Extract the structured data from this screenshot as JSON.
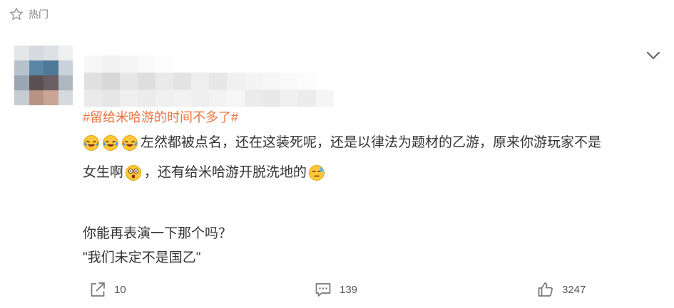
{
  "header": {
    "hot_label": "热门"
  },
  "comment": {
    "topic": "#留给米哈游的时间不多了#",
    "line1": "左然都被点名，还在这装死呢，还是以律法为题材的乙游，原来你游玩家不是",
    "line2_a": "女生啊",
    "line2_b": "，还有给米哈游开脱洗地的",
    "line5": "你能再表演一下那个吗？",
    "line6": "\"我们未定不是国乙\""
  },
  "actions": {
    "repost_count": "10",
    "comment_count": "139",
    "like_count": "3247"
  },
  "colors": {
    "topic": "#eb7340",
    "text": "#333333",
    "muted": "#808080"
  },
  "icons": [
    "star-icon",
    "chevron-down-icon",
    "laughing-crying-emoji",
    "shocked-emoji",
    "sweat-emoji",
    "repost-icon",
    "comment-icon",
    "like-icon"
  ]
}
